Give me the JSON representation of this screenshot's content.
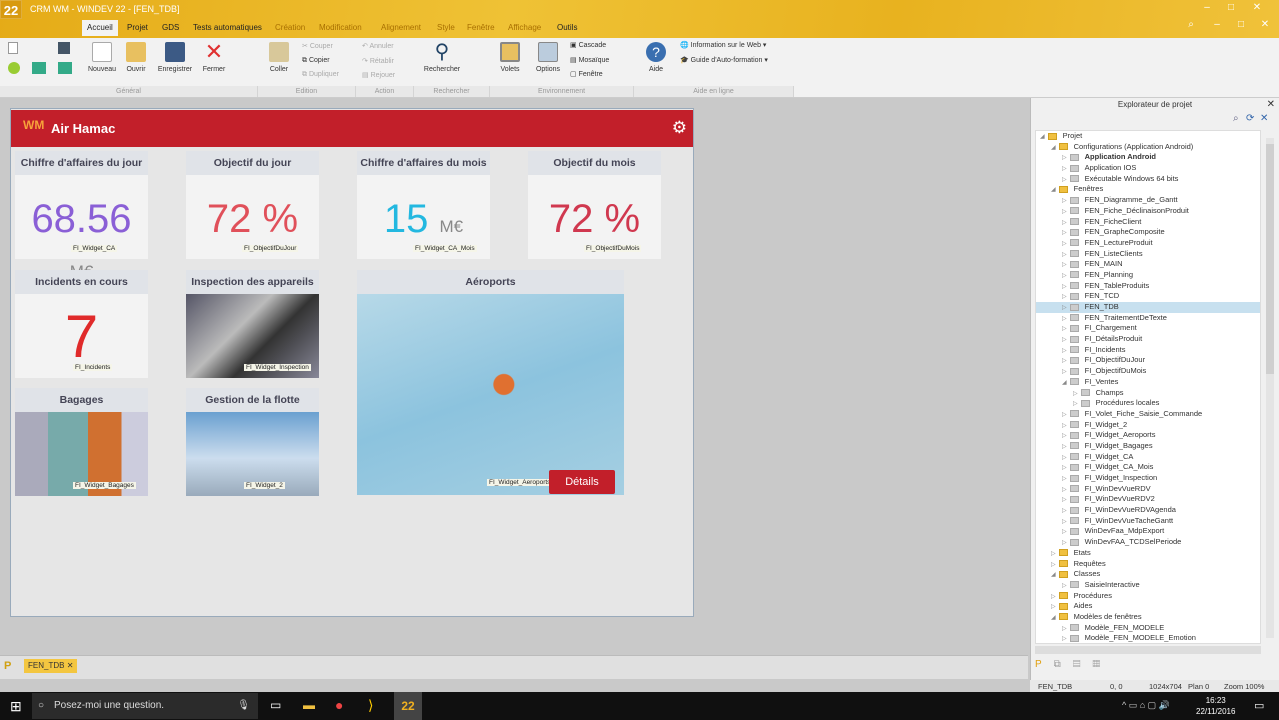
{
  "window": {
    "title": "CRM WM - WINDEV 22 - [FEN_TDB]",
    "logo": "22"
  },
  "tabs": [
    {
      "label": "Accueil",
      "active": true
    },
    {
      "label": "Projet"
    },
    {
      "label": "GDS"
    },
    {
      "label": "Tests automatiques"
    },
    {
      "label": "Création",
      "dim": true
    },
    {
      "label": "Modification",
      "dim": true
    },
    {
      "label": "Alignement",
      "dim": true
    },
    {
      "label": "Style",
      "dim": true
    },
    {
      "label": "Fenêtre",
      "dim": true
    },
    {
      "label": "Affichage",
      "dim": true
    },
    {
      "label": "Outils"
    }
  ],
  "ribbon": {
    "general": {
      "label": "Général",
      "nouveau": "Nouveau",
      "ouvrir": "Ouvrir",
      "enregistrer": "Enregistrer",
      "fermer": "Fermer"
    },
    "edition": {
      "label": "Edition",
      "coller": "Coller",
      "couper": "Couper",
      "copier": "Copier",
      "dupliquer": "Dupliquer"
    },
    "action": {
      "label": "Action",
      "annuler": "Annuler",
      "retablir": "Rétablir",
      "rejouer": "Rejouer"
    },
    "rechercher": {
      "label": "Rechercher",
      "button": "Rechercher"
    },
    "environnement": {
      "label": "Environnement",
      "volets": "Volets",
      "options": "Options",
      "cascade": "Cascade",
      "mosaique": "Mosaïque",
      "fenetre": "Fenêtre"
    },
    "aide": {
      "label": "Aide en ligne",
      "aide": "Aide",
      "info_web": "Information sur le Web",
      "guide": "Guide d'Auto-formation"
    }
  },
  "app": {
    "title": "Air Hamac",
    "widgets": [
      {
        "title": "Chiffre d'affaires du jour",
        "value": "68.56",
        "unit": "M€",
        "label": "FI_Widget_CA",
        "color": "#8a5fd6"
      },
      {
        "title": "Objectif du jour",
        "value": "72 %",
        "label": "FI_ObjectifDuJour",
        "color": "#e0505a"
      },
      {
        "title": "Chiffre d'affaires du mois",
        "value": "15",
        "unit": "M€",
        "label": "FI_Widget_CA_Mois",
        "color": "#23b8e0"
      },
      {
        "title": "Objectif du mois",
        "value": "72 %",
        "label": "FI_ObjectifDuMois",
        "color": "#d0384f"
      },
      {
        "title": "Incidents en cours",
        "value": "7",
        "label": "FI_Incidents",
        "color": "#e02a2a"
      },
      {
        "title": "Inspection des appareils",
        "label": "FI_Widget_Inspection"
      },
      {
        "title": "Aéroports",
        "label": "FI_Widget_Aeroports",
        "button": "Détails"
      },
      {
        "title": "Bagages",
        "label": "FI_Widget_Bagages"
      },
      {
        "title": "Gestion de la flotte",
        "label": "FI_Widget_2"
      }
    ]
  },
  "explorer": {
    "title": "Explorateur de projet",
    "items": [
      {
        "l": "Projet",
        "d": 0,
        "o": true
      },
      {
        "l": "Configurations (Application Android)",
        "d": 1,
        "o": true
      },
      {
        "l": "Application Android",
        "d": 2,
        "b": true
      },
      {
        "l": "Application IOS",
        "d": 2
      },
      {
        "l": "Exécutable Windows 64 bits",
        "d": 2
      },
      {
        "l": "Fenêtres",
        "d": 1,
        "o": true
      },
      {
        "l": "FEN_Diagramme_de_Gantt",
        "d": 2
      },
      {
        "l": "FEN_Fiche_DéclinaisonProduit",
        "d": 2
      },
      {
        "l": "FEN_FicheClient",
        "d": 2
      },
      {
        "l": "FEN_GrapheComposite",
        "d": 2
      },
      {
        "l": "FEN_LectureProduit",
        "d": 2
      },
      {
        "l": "FEN_ListeClients",
        "d": 2
      },
      {
        "l": "FEN_MAIN",
        "d": 2
      },
      {
        "l": "FEN_Planning",
        "d": 2
      },
      {
        "l": "FEN_TableProduits",
        "d": 2
      },
      {
        "l": "FEN_TCD",
        "d": 2
      },
      {
        "l": "FEN_TDB",
        "d": 2,
        "sel": true
      },
      {
        "l": "FEN_TraitementDeTexte",
        "d": 2
      },
      {
        "l": "FI_Chargement",
        "d": 2
      },
      {
        "l": "FI_DétailsProduit",
        "d": 2
      },
      {
        "l": "FI_Incidents",
        "d": 2
      },
      {
        "l": "FI_ObjectifDuJour",
        "d": 2
      },
      {
        "l": "FI_ObjectifDuMois",
        "d": 2
      },
      {
        "l": "FI_Ventes",
        "d": 2,
        "o": true
      },
      {
        "l": "Champs",
        "d": 3
      },
      {
        "l": "Procédures locales",
        "d": 3
      },
      {
        "l": "FI_Volet_Fiche_Saisie_Commande",
        "d": 2
      },
      {
        "l": "FI_Widget_2",
        "d": 2
      },
      {
        "l": "FI_Widget_Aeroports",
        "d": 2
      },
      {
        "l": "FI_Widget_Bagages",
        "d": 2
      },
      {
        "l": "FI_Widget_CA",
        "d": 2
      },
      {
        "l": "FI_Widget_CA_Mois",
        "d": 2
      },
      {
        "l": "FI_Widget_Inspection",
        "d": 2
      },
      {
        "l": "FI_WinDevVueRDV",
        "d": 2
      },
      {
        "l": "FI_WinDevVueRDV2",
        "d": 2
      },
      {
        "l": "FI_WinDevVueRDVAgenda",
        "d": 2
      },
      {
        "l": "FI_WinDevVueTacheGantt",
        "d": 2
      },
      {
        "l": "WinDevFaa_MdpExport",
        "d": 2
      },
      {
        "l": "WinDevFAA_TCDSelPeriode",
        "d": 2
      },
      {
        "l": "Etats",
        "d": 1
      },
      {
        "l": "Requêtes",
        "d": 1
      },
      {
        "l": "Classes",
        "d": 1,
        "o": true
      },
      {
        "l": "SaisieInteractive",
        "d": 2
      },
      {
        "l": "Procédures",
        "d": 1
      },
      {
        "l": "Aides",
        "d": 1
      },
      {
        "l": "Modèles de fenêtres",
        "d": 1,
        "o": true
      },
      {
        "l": "Modèle_FEN_MODELE",
        "d": 2
      },
      {
        "l": "Modèle_FEN_MODELE_Emotion",
        "d": 2
      }
    ]
  },
  "bottom_tab": "FEN_TDB",
  "status": {
    "window": "FEN_TDB",
    "pos": "0, 0",
    "size": "1024x704",
    "plan": "Plan 0",
    "zoom": "Zoom 100%"
  },
  "taskbar": {
    "search": "Posez-moi une question.",
    "time": "16:23",
    "date": "22/11/2016"
  },
  "colors": {
    "accent": "#e8b21f",
    "header": "#c21f2a"
  }
}
